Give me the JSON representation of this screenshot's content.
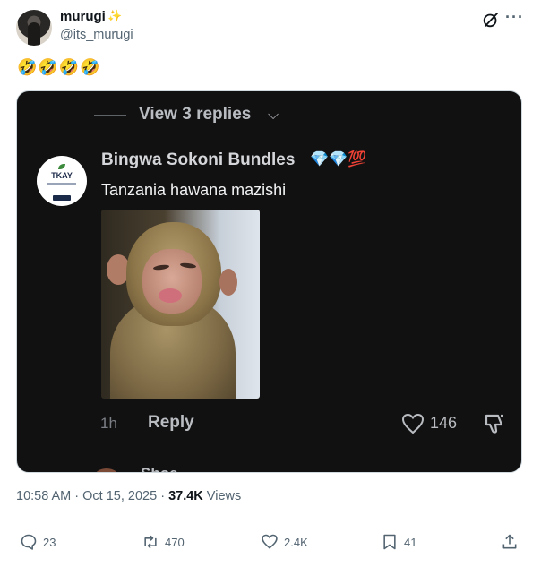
{
  "author": {
    "display_name": "murugi",
    "handle": "@its_murugi",
    "badge_icon": "magic-wand-icon"
  },
  "post": {
    "text": "🤣🤣🤣🤣"
  },
  "media": {
    "view_replies": "View 3 replies",
    "logo_text": "TKAY",
    "commenter": "Bingwa Sokoni Bundles",
    "badges": "💎💎💯",
    "comment": "Tanzania hawana mazishi",
    "time_ago": "1h",
    "reply_label": "Reply",
    "like_count": "146",
    "next_commenter_partial": "Shoe",
    "background": "#111112"
  },
  "meta": {
    "timestamp": "10:58 AM · Oct 15, 2025 · ",
    "views_count": "37.4K",
    "views_label": " Views"
  },
  "actions": {
    "replies": "23",
    "reposts": "470",
    "likes": "2.4K",
    "bookmarks": "41"
  },
  "colors": {
    "text_primary": "#0f1419",
    "text_secondary": "#536471"
  }
}
